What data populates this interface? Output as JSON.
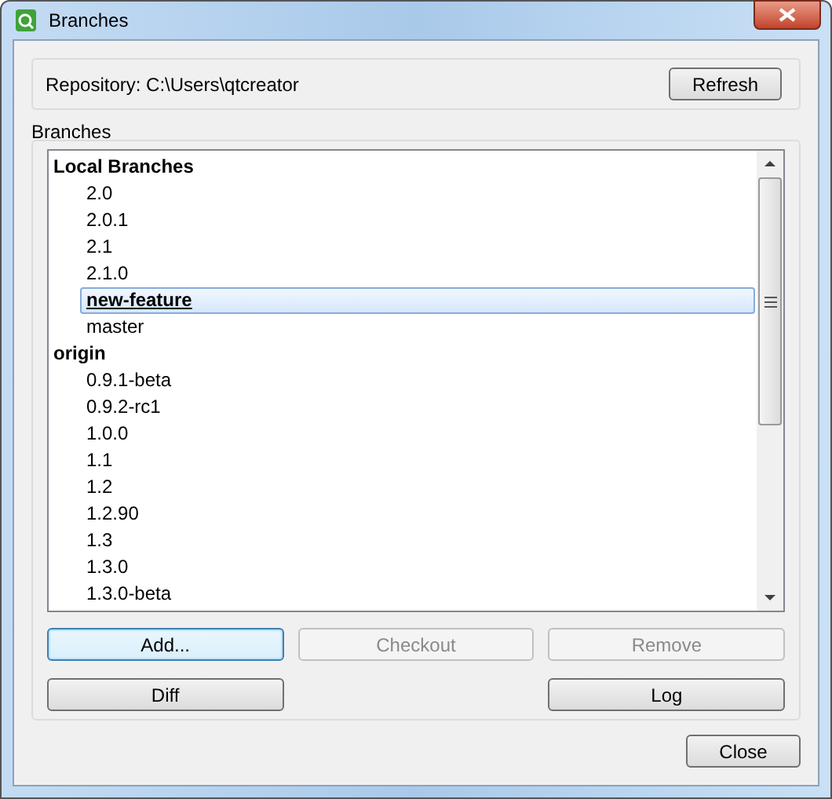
{
  "window": {
    "title": "Branches"
  },
  "repository": {
    "label": "Repository: C:\\Users\\qtcreator",
    "button": "Refresh"
  },
  "branches": {
    "title": "Branches",
    "groups": [
      {
        "name": "Local Branches",
        "children": [
          {
            "name": "2.0",
            "selected": false
          },
          {
            "name": "2.0.1",
            "selected": false
          },
          {
            "name": "2.1",
            "selected": false
          },
          {
            "name": "2.1.0",
            "selected": false
          },
          {
            "name": "new-feature",
            "selected": true
          },
          {
            "name": "master",
            "selected": false
          }
        ]
      },
      {
        "name": "origin",
        "children": [
          {
            "name": "0.9.1-beta",
            "selected": false
          },
          {
            "name": "0.9.2-rc1",
            "selected": false
          },
          {
            "name": "1.0.0",
            "selected": false
          },
          {
            "name": "1.1",
            "selected": false
          },
          {
            "name": "1.2",
            "selected": false
          },
          {
            "name": "1.2.90",
            "selected": false
          },
          {
            "name": "1.3",
            "selected": false
          },
          {
            "name": "1.3.0",
            "selected": false
          },
          {
            "name": "1.3.0-beta",
            "selected": false
          }
        ]
      }
    ],
    "button_rows": [
      {
        "left": {
          "label": "Add...",
          "disabled": false,
          "focused": true
        },
        "middle": {
          "label": "Checkout",
          "disabled": true,
          "focused": false
        },
        "right": {
          "label": "Remove",
          "disabled": true,
          "focused": false
        }
      },
      {
        "left": {
          "label": "Diff",
          "disabled": false,
          "focused": false
        },
        "right": {
          "label": "Log",
          "disabled": false,
          "focused": false
        }
      }
    ]
  },
  "close_button": "Close"
}
